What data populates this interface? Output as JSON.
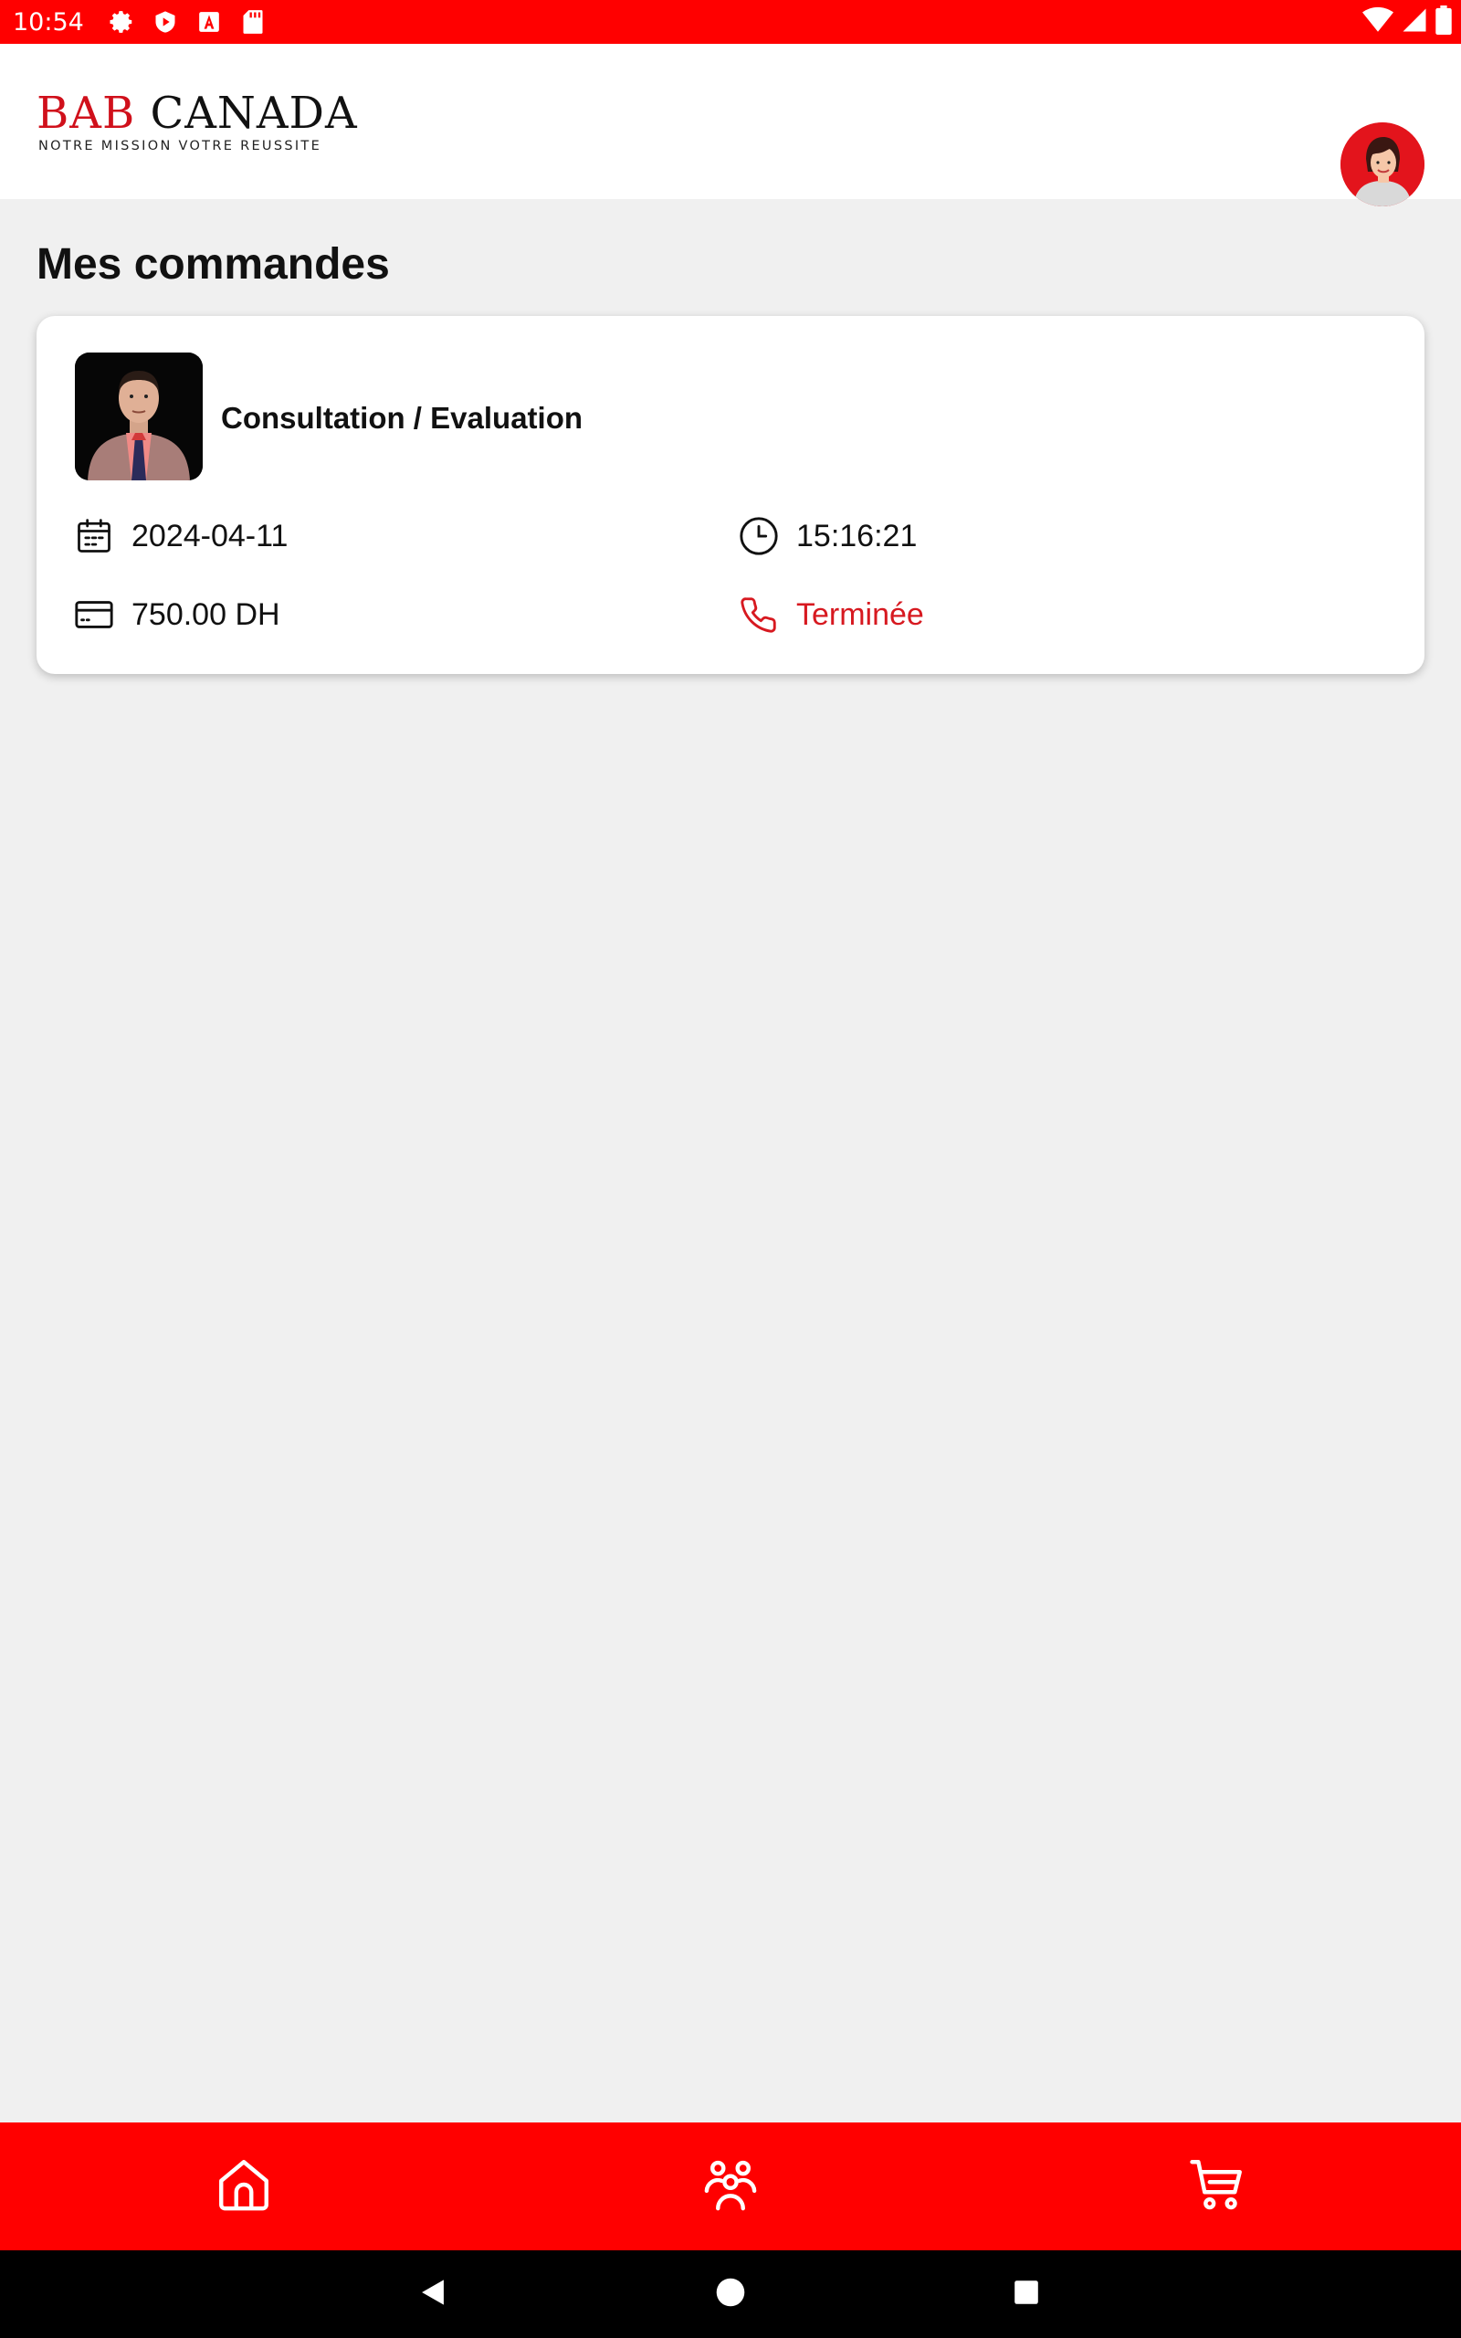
{
  "status_bar": {
    "time": "10:54",
    "left_icons": [
      "settings-icon",
      "play-shield-icon",
      "a-icon",
      "sd-card-icon"
    ],
    "right_icons": [
      "wifi-icon",
      "signal-icon",
      "battery-icon"
    ]
  },
  "header": {
    "logo": {
      "word_part1": "BAB ",
      "word_part2": "CANADA",
      "tagline": "NOTRE MISSION VOTRE REUSSITE"
    },
    "avatar_icon": "user-avatar"
  },
  "page": {
    "title": "Mes commandes"
  },
  "orders": [
    {
      "title": "Consultation / Evaluation",
      "date": "2024-04-11",
      "time": "15:16:21",
      "price": "750.00 DH",
      "status": "Terminée",
      "status_color": "#d71920",
      "icons": {
        "date": "calendar-icon",
        "time": "clock-icon",
        "price": "credit-card-icon",
        "status": "phone-icon"
      }
    }
  ],
  "bottom_nav": {
    "items": [
      "home-icon",
      "users-icon",
      "cart-icon"
    ]
  },
  "system_nav": {
    "items": [
      "back-icon",
      "home-circle-icon",
      "recents-icon"
    ]
  },
  "colors": {
    "brand_red": "#ff0000",
    "accent_red": "#d71920",
    "background": "#f0f0f0",
    "card": "#ffffff"
  }
}
